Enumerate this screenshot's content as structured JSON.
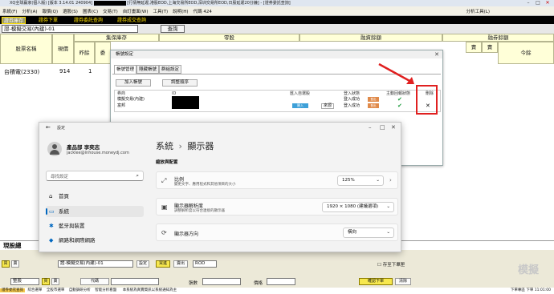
{
  "titlebar": {
    "text_a": "XQ全球贏家(個人版) [版本 3.14.01 240904]",
    "text_b": "[行情無延遲,港股EOD,上海交易所EOD,深圳交易所EOD,日股延遲20分鐘] - [證券委託查詢]"
  },
  "menubar": {
    "items": [
      "系統(F)",
      "分析(A)",
      "報價(Q)",
      "選股(S)",
      "圖表(C)",
      "交易(T)",
      "自訂畫面(W)",
      "工具(T)",
      "說明(H)"
    ],
    "code_label": "代碼 424",
    "analysis_tools": "分析工具(L)"
  },
  "tabs": [
    "證券庫存",
    "證券下單",
    "證券委託查詢",
    "證券成交查詢"
  ],
  "account_row": {
    "account": "證-模擬交易(內建)-01",
    "query_label": "查詢"
  },
  "grid": {
    "group_headers": [
      "集保庫存",
      "零股",
      "融資餘額",
      "融券餘額"
    ],
    "columns": [
      "股票名稱",
      "現價",
      "昨餘",
      "委",
      "賣",
      "今餘"
    ],
    "rows": [
      {
        "name": "台積電(2330)",
        "price": "914",
        "qty": "1"
      }
    ]
  },
  "order_settings": {
    "title": "帳號設定",
    "tabs": [
      "帳號管理",
      "隱藏帳號",
      "群組設定"
    ],
    "add_account": "加入帳號",
    "reorder": "調整順序",
    "headers": [
      "券商",
      "ID",
      "匯入自選股",
      "登入狀態",
      "主動回報狀態",
      "刪除"
    ],
    "rows": [
      {
        "broker": "模擬交易(內建)",
        "login": "登入成功",
        "login_btn": "登出"
      },
      {
        "broker": "富邦",
        "import": "匯入",
        "source": "來源",
        "login": "登入成功",
        "login_btn": "登出"
      }
    ],
    "delete_icon": "✕"
  },
  "settings": {
    "app_title": "設定",
    "user_name": "產品部 李奕志",
    "user_email": "jacklee@inhouse.moneydj.com",
    "search_placeholder": "尋找設定",
    "nav": [
      {
        "label": "首頁",
        "icon": "home-icon"
      },
      {
        "label": "系統",
        "icon": "system-icon"
      },
      {
        "label": "藍牙與裝置",
        "icon": "bluetooth-icon"
      },
      {
        "label": "網路和網際網路",
        "icon": "wifi-icon"
      }
    ],
    "breadcrumb_parent": "系統",
    "breadcrumb_sep": "›",
    "breadcrumb_current": "顯示器",
    "section": "縮放與配置",
    "cards": [
      {
        "title": "比例",
        "desc": "變更文字、應用程式和其他項目的大小",
        "value": "125%"
      },
      {
        "title": "顯示器解析度",
        "desc": "調整解析度以符合連接的顯示器",
        "value": "1920 × 1080 (建議選項)"
      },
      {
        "title": "顯示器方向",
        "desc": "",
        "value": "橫向"
      }
    ]
  },
  "bottom": {
    "left_label": "現股總",
    "account_select": "證-模擬交易(內建)-01",
    "set_btn": "設定",
    "buy": "買進",
    "sell": "賣出",
    "rod": "ROD",
    "store_order": "存至下單匣",
    "type_select": "整股",
    "code_btn": "代碼",
    "qty_label": "張數",
    "price_label": "價格",
    "flag_a": "買",
    "flag_b": "賣",
    "submit": "確認下單",
    "clear": "清除",
    "watermark": "模擬"
  },
  "status_bar": {
    "tabs": [
      "證券委託查詢",
      "綜合選單",
      "全股市選單",
      "自動調研分析",
      "智能分析看盤"
    ],
    "notice": "本系統為真實資訊以系統通知為主",
    "right": "下單專區  下單  11:01:00"
  }
}
